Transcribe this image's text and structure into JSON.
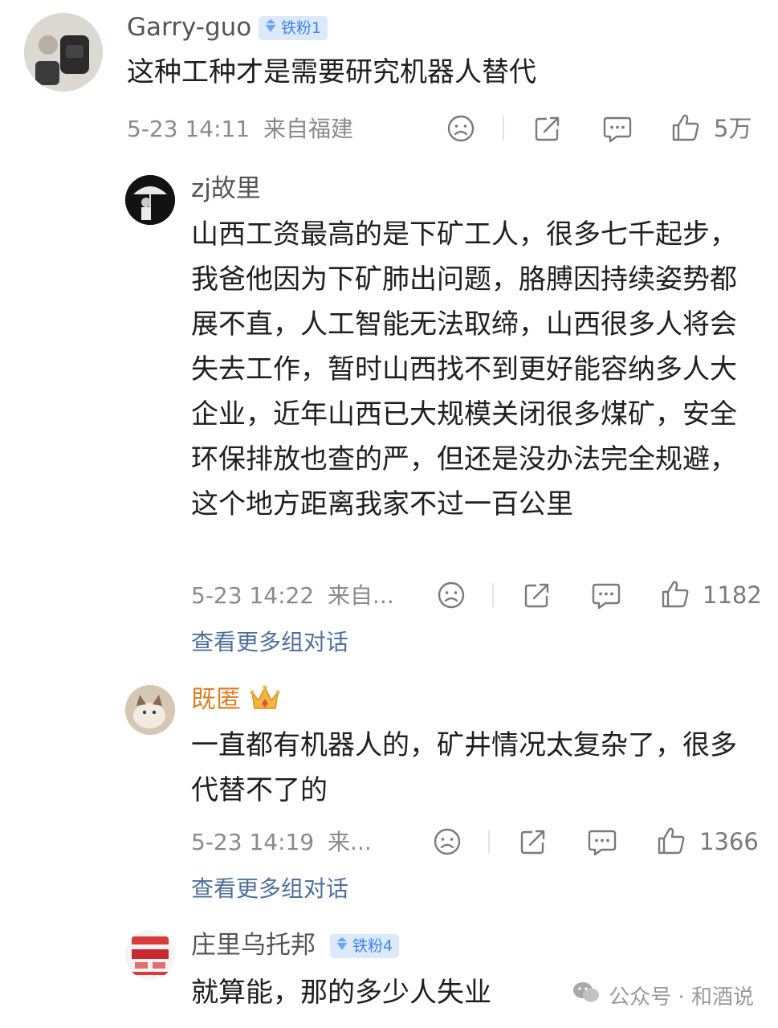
{
  "comments": [
    {
      "username": "Garry-guo",
      "badge": "铁粉1",
      "text": "这种工种才是需要研究机器人替代",
      "time": "5-23 14:11",
      "location": "来自福建",
      "likes": "5万"
    },
    {
      "username": "zj故里",
      "text": "山西工资最高的是下矿工人，很多七千起步，我爸他因为下矿肺出问题，胳膊因持续姿势都展不直，人工智能无法取缔，山西很多人将会失去工作，暂时山西找不到更好能容纳多人大企业，近年山西已大规模关闭很多煤矿，安全环保排放也查的严，但还是没办法完全规避，这个地方距离我家不过一百公里",
      "time": "5-23 14:22",
      "location": "来自...",
      "likes": "1182",
      "more_link": "查看更多组对话"
    },
    {
      "username": "既匿",
      "text": "一直都有机器人的，矿井情况太复杂了，很多代替不了的",
      "time": "5-23 14:19",
      "location": "来...",
      "likes": "1366",
      "more_link": "查看更多组对话"
    },
    {
      "username": "庄里乌托邦",
      "badge": "铁粉4",
      "text": "就算能，那的多少人失业"
    }
  ],
  "watermark": "公众号 · 和酒说",
  "colors": {
    "badge_bg": "#dbe9fb",
    "badge_text": "#3f86e6",
    "link": "#4f6f9c",
    "vip_name": "#d9822b"
  },
  "icons": [
    "dislike-icon",
    "share-icon",
    "reply-icon",
    "like-icon",
    "crown-icon",
    "diamond-icon",
    "wechat-icon"
  ]
}
